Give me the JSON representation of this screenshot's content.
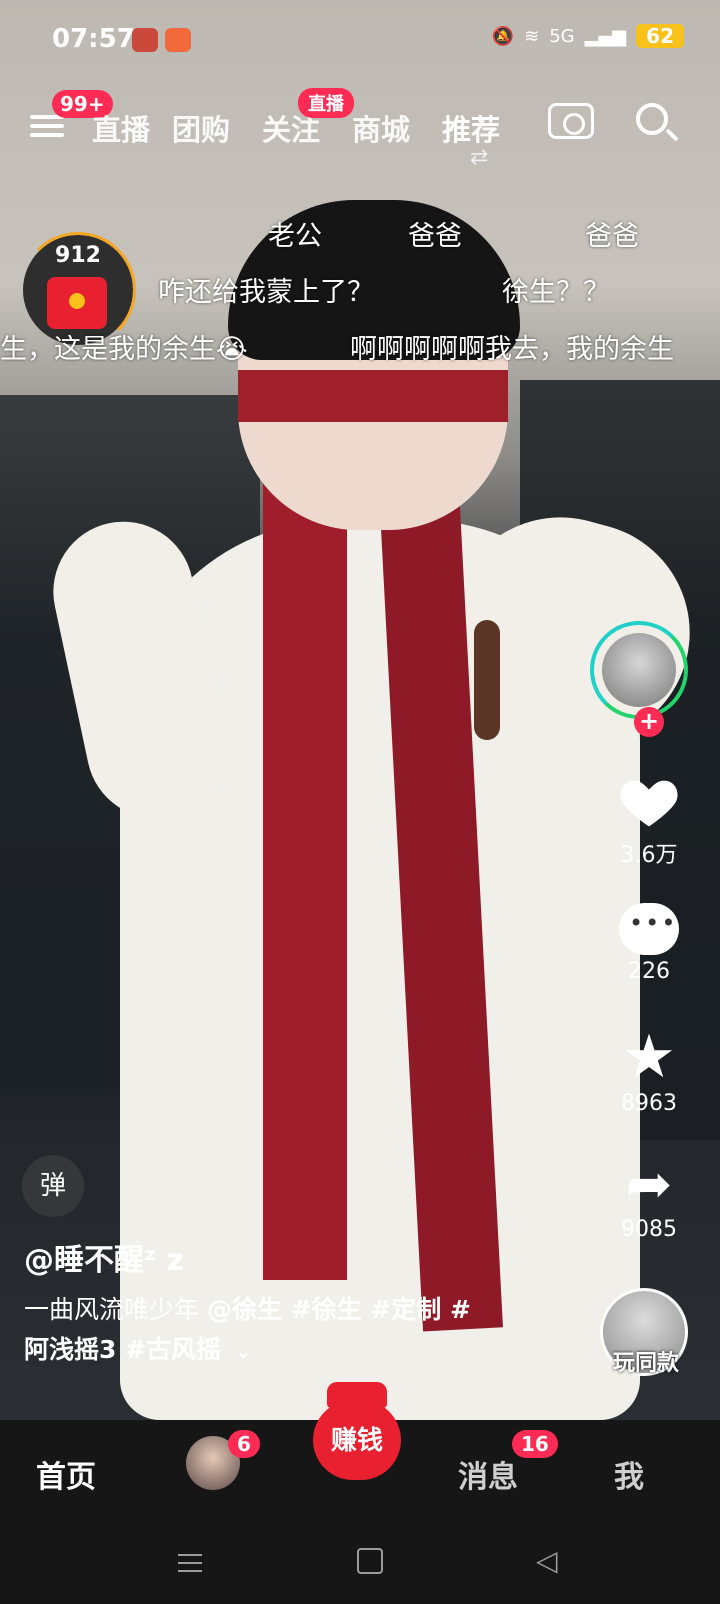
{
  "status_bar": {
    "time": "07:57",
    "network": "5G",
    "battery": "62"
  },
  "top_nav": {
    "menu_badge": "99+",
    "tabs": [
      "直播",
      "团购",
      "关注",
      "商城",
      "推荐"
    ],
    "live_badge": "直播",
    "swap_glyph": "⇄"
  },
  "red_packet": {
    "count": "912"
  },
  "danmaku": [
    "老公",
    "爸爸",
    "爸爸",
    "咋还给我蒙上了？",
    "徐生？？",
    "生，这是我的余生😭",
    "啊啊啊啊啊我去，我的余生"
  ],
  "actions": {
    "likes": "3.6万",
    "comments": "226",
    "favorites": "8963",
    "shares": "9085",
    "follow_plus": "+"
  },
  "danmaku_toggle": "弹",
  "video": {
    "author": "@睡不醒ᶻ z",
    "caption_line1_plain": "一曲风流唯少年 ",
    "caption_line1_tags": "@徐生 #徐生 #定制 #",
    "caption_line2": "阿浅摇3 #古风摇",
    "expand_icon": "⌄",
    "play_same": "玩同款"
  },
  "bottom_nav": {
    "home": "首页",
    "friends_badge": "6",
    "earn": "赚钱",
    "messages": "消息",
    "messages_badge": "16",
    "me": "我"
  },
  "icons": {
    "menu": "menu-icon",
    "camera": "camera-icon",
    "search": "search-icon",
    "heart": "heart-icon",
    "comment": "comment-icon",
    "star": "star-icon",
    "share": "share-icon"
  },
  "colors": {
    "accent": "#fe2c55",
    "red_packet": "#e8202f",
    "battery": "#f8c21a",
    "nav_bg": "#161616"
  }
}
